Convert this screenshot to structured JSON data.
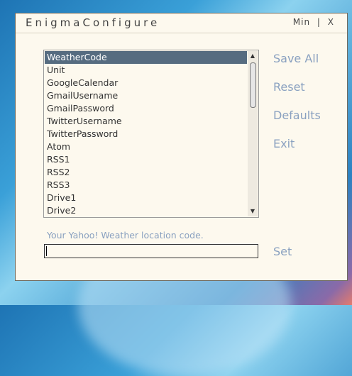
{
  "window": {
    "title": "EnigmaConfigure",
    "min_label": "Min",
    "separator": "|",
    "close_label": "X"
  },
  "settings_list": {
    "items": [
      "WeatherCode",
      "Unit",
      "GoogleCalendar",
      "GmailUsername",
      "GmailPassword",
      "TwitterUsername",
      "TwitterPassword",
      "Atom",
      "RSS1",
      "RSS2",
      "RSS3",
      "Drive1",
      "Drive2"
    ],
    "selected": "WeatherCode"
  },
  "actions": {
    "save_all": "Save All",
    "reset": "Reset",
    "defaults": "Defaults",
    "exit": "Exit"
  },
  "editor": {
    "description": "Your Yahoo! Weather location code.",
    "value": "",
    "set_label": "Set"
  },
  "colors": {
    "window_bg": "#fdf9ee",
    "selection": "#566c80",
    "action_text": "#8aa1c0"
  }
}
